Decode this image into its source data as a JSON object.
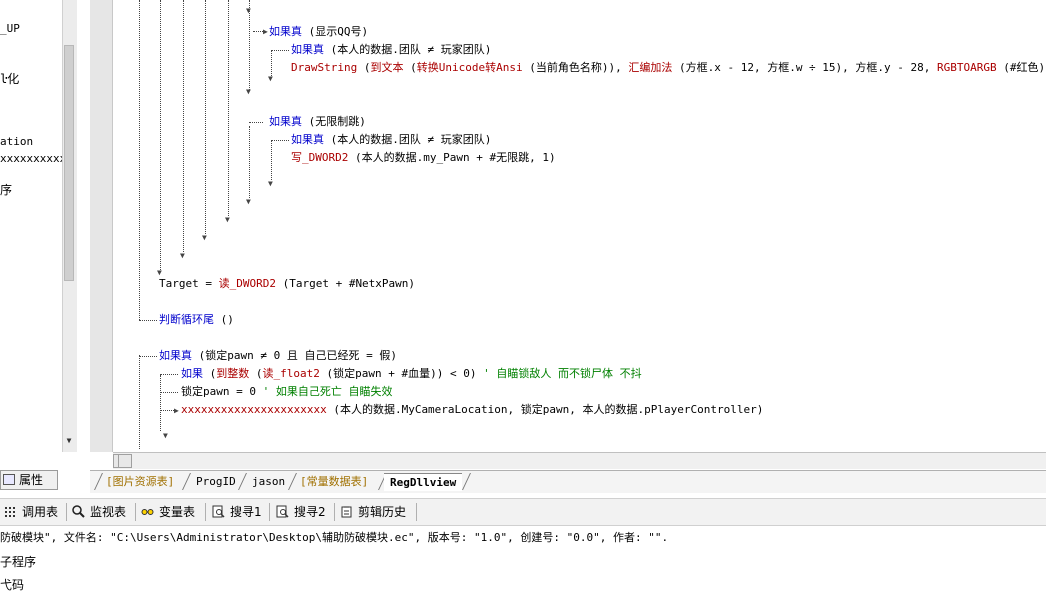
{
  "left_panel": {
    "lines": [
      "_UP",
      "ŀ化",
      "ation",
      "xxxxxxxxxxx",
      "序"
    ],
    "properties_tab": "属性"
  },
  "code": {
    "line1_kw": "如果真",
    "line1_arg": " (显示QQ号)",
    "line2_kw": "如果真",
    "line2_arg": " (本人的数据.团队 ≠ 玩家团队)",
    "line3_fn": "DrawString",
    "line3_a": " (",
    "line3_b": "到文本",
    "line3_c": " (",
    "line3_d": "转换Unicode转Ansi",
    "line3_e": " (当前角色名称)), ",
    "line3_f": "汇编加法",
    "line3_g": " (方框.x - 12, 方框.w ÷ 15), 方框.y - 28, ",
    "line3_h": "RGBTOARGB",
    "line3_i": " (#红色),",
    "line4_kw": "如果真",
    "line4_arg": " (无限制跳)",
    "line5_kw": "如果真",
    "line5_arg": " (本人的数据.团队 ≠ 玩家团队)",
    "line6_fn": "写_DWORD2",
    "line6_arg": " (本人的数据.my_Pawn + #无限跳, 1)",
    "line7_a": "Target = ",
    "line7_fn": "读_DWORD2",
    "line7_b": " (Target + #NetxPawn)",
    "line8_kw": "判断循环尾",
    "line8_arg": " ()",
    "line9_kw": "如果真",
    "line9_arg": " (锁定pawn ≠ 0 且 自己已经死 = 假)",
    "line10_kw": "如果",
    "line10_a": " (",
    "line10_fn1": "到整数",
    "line10_b": " (",
    "line10_fn2": "读_float2",
    "line10_c": " (锁定pawn + #血量)) < 0) ",
    "line10_cm": "' 自瞄锁敌人 而不锁尸体 不抖",
    "line11_a": "锁定pawn = 0 ",
    "line11_cm": "' 如果自己死亡 自瞄失效",
    "line12_fn": "xxxxxxxxxxxxxxxxxxxxxx",
    "line12_arg": " (本人的数据.MyCameraLocation, 锁定pawn, 本人的数据.pPlayerController)"
  },
  "tabs": [
    {
      "label": "[图片资源表]",
      "style": "orange"
    },
    {
      "label": "ProgID",
      "style": "normal"
    },
    {
      "label": "jason",
      "style": "normal"
    },
    {
      "label": "[常量数据表]",
      "style": "orange"
    },
    {
      "label": "RegDllview",
      "style": "active"
    }
  ],
  "toolbar": {
    "call_table": "调用表",
    "watch_table": "监视表",
    "var_table": "变量表",
    "search1": "搜寻1",
    "search2": "搜寻2",
    "clip_history": "剪辑历史"
  },
  "output": {
    "line1": "防破模块\", 文件名: \"C:\\Users\\Administrator\\Desktop\\辅助防破模块.ec\", 版本号: \"1.0\", 创建号: \"0.0\", 作者: \"\".",
    "line2": "子程序",
    "line3": "弋码"
  },
  "colors": {
    "keyword": "#0000cc",
    "function": "#aa0000",
    "comment": "#008000",
    "tab_orange": "#a07000"
  }
}
